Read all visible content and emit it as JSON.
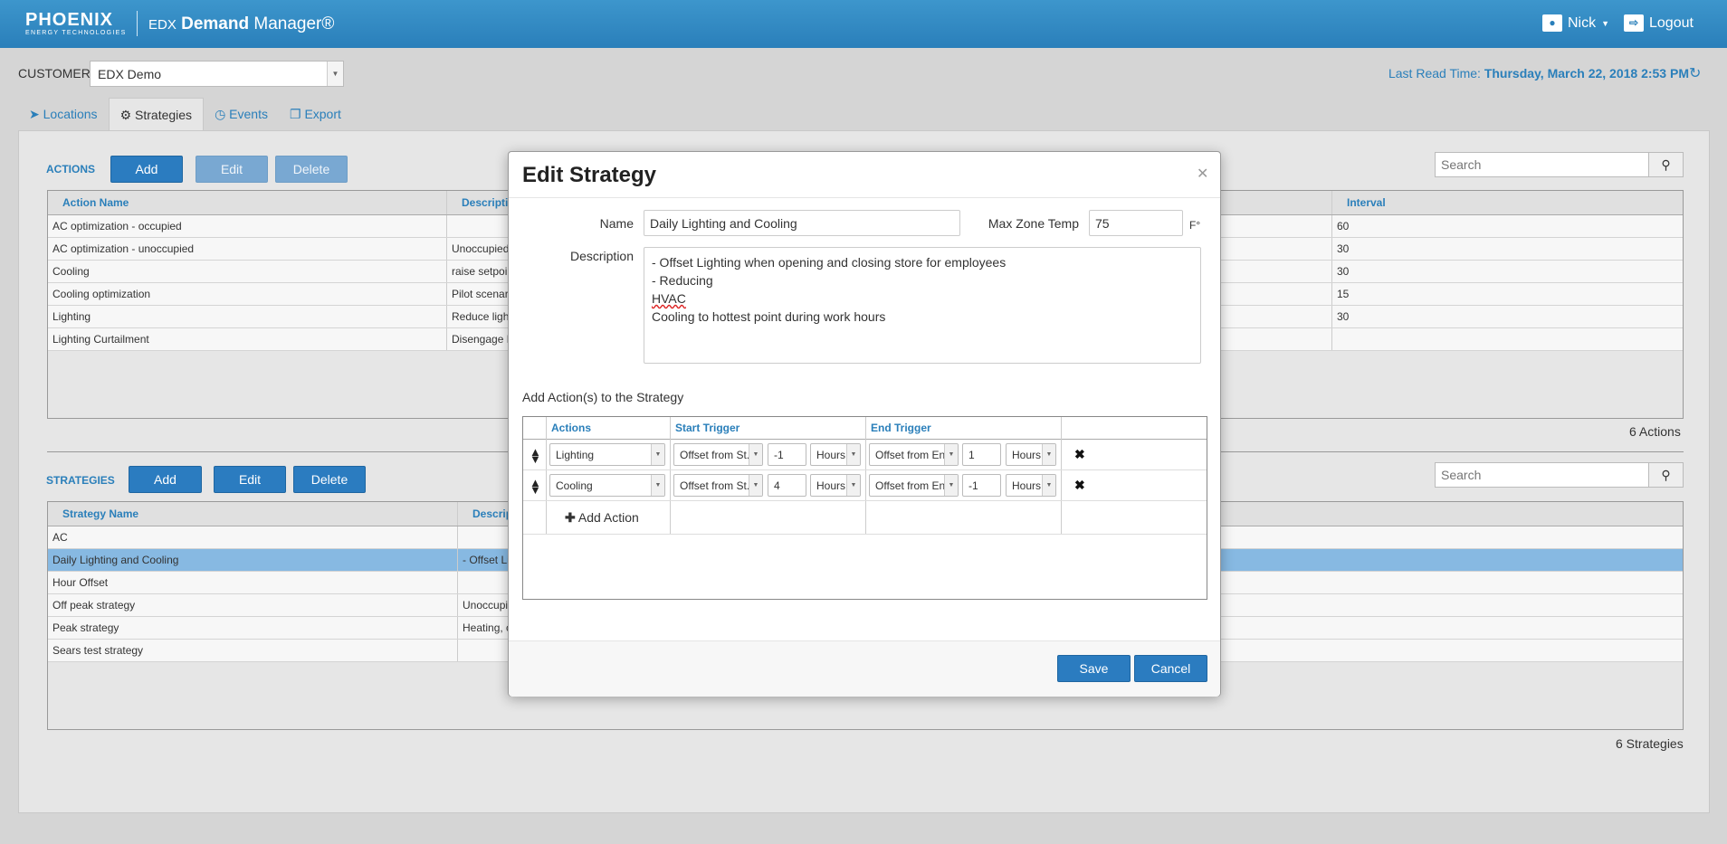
{
  "header": {
    "logo_main": "PHOENIX",
    "logo_sub": "ENERGY TECHNOLOGIES",
    "app_prefix": "EDX",
    "app_name_bold": "Demand",
    "app_name_rest": " Manager®",
    "user_name": "Nick",
    "logout_label": "Logout"
  },
  "customer": {
    "label": "CUSTOMER",
    "selected": "EDX Demo"
  },
  "last_read": {
    "label": "Last Read Time: ",
    "value": "Thursday, March 22, 2018 2:53 PM"
  },
  "tabs": [
    {
      "label": "Locations",
      "icon": "location-arrow-icon"
    },
    {
      "label": "Strategies",
      "icon": "gear-icon"
    },
    {
      "label": "Events",
      "icon": "clock-icon"
    },
    {
      "label": "Export",
      "icon": "copy-icon"
    }
  ],
  "actions": {
    "title": "ACTIONS",
    "add": "Add",
    "edit": "Edit",
    "delete": "Delete",
    "search_placeholder": "Search",
    "columns": [
      "Action Name",
      "Description",
      "Interval"
    ],
    "rows": [
      {
        "name": "AC optimization - occupied",
        "desc": "",
        "interval": "60"
      },
      {
        "name": "AC optimization - unoccupied",
        "desc": "Unoccupied",
        "interval": "30"
      },
      {
        "name": "Cooling",
        "desc": "raise setpoi",
        "interval": "30"
      },
      {
        "name": "Cooling optimization",
        "desc": "Pilot scenar",
        "interval": "15"
      },
      {
        "name": "Lighting",
        "desc": "Reduce ligh",
        "interval": "30"
      },
      {
        "name": "Lighting Curtailment",
        "desc": "Disengage L",
        "interval": ""
      }
    ],
    "count": "6 Actions"
  },
  "strategies": {
    "title": "STRATEGIES",
    "add": "Add",
    "edit": "Edit",
    "delete": "Delete",
    "search_placeholder": "Search",
    "columns": [
      "Strategy Name",
      "Descrip"
    ],
    "rows": [
      {
        "name": "AC",
        "desc": ""
      },
      {
        "name": "Daily Lighting and Cooling",
        "desc": "- Offset Li"
      },
      {
        "name": "Hour Offset",
        "desc": ""
      },
      {
        "name": "Off peak strategy",
        "desc": "Unoccupie"
      },
      {
        "name": "Peak strategy",
        "desc": "Heating, c"
      },
      {
        "name": "Sears test strategy",
        "desc": ""
      }
    ],
    "count": "6 Strategies"
  },
  "modal": {
    "title": "Edit Strategy",
    "name_label": "Name",
    "name_value": "Daily Lighting and Cooling",
    "max_zone_label": "Max Zone Temp",
    "max_zone_value": "75",
    "max_zone_unit": "F°",
    "desc_label": "Description",
    "desc_line1": "- Offset Lighting when opening and closing store for employees",
    "desc_line2a": "- Reducing ",
    "desc_line2b": "HVAC",
    "desc_line2c": " Cooling to hottest point during work hours",
    "add_actions_label": "Add Action(s) to the Strategy",
    "table_headers": [
      "Actions",
      "Start Trigger",
      "End Trigger"
    ],
    "rows": [
      {
        "action": "Lighting",
        "start_trigger": "Offset from St...",
        "start_value": "-1",
        "start_unit": "Hours",
        "end_trigger": "Offset from End",
        "end_value": "1",
        "end_unit": "Hours"
      },
      {
        "action": "Cooling",
        "start_trigger": "Offset from St...",
        "start_value": "4",
        "start_unit": "Hours",
        "end_trigger": "Offset from End",
        "end_value": "-1",
        "end_unit": "Hours"
      }
    ],
    "add_action": "Add Action",
    "save": "Save",
    "cancel": "Cancel"
  }
}
